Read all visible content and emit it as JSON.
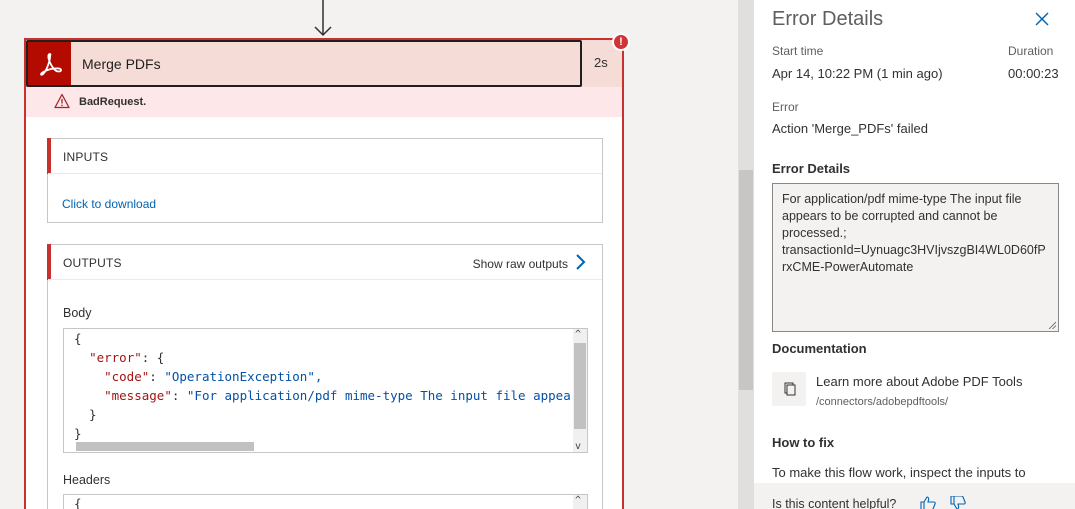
{
  "card": {
    "title": "Merge PDFs",
    "duration": "2s",
    "error_badge": "!",
    "status": "BadRequest.",
    "inputs": {
      "title": "INPUTS",
      "link": "Click to download"
    },
    "outputs": {
      "title": "OUTPUTS",
      "raw_link": "Show raw outputs",
      "body_label": "Body",
      "body_lines": [
        {
          "pre": "{",
          "key": "",
          "mid": "",
          "val": ""
        },
        {
          "pre": "  ",
          "key": "\"error\"",
          "mid": ": {",
          "val": ""
        },
        {
          "pre": "    ",
          "key": "\"code\"",
          "mid": ": ",
          "val": "\"OperationException\","
        },
        {
          "pre": "    ",
          "key": "\"message\"",
          "mid": ": ",
          "val": "\"For application/pdf mime-type The input file appear"
        },
        {
          "pre": "  }",
          "key": "",
          "mid": "",
          "val": ""
        },
        {
          "pre": "}",
          "key": "",
          "mid": "",
          "val": ""
        }
      ],
      "headers_label": "Headers",
      "headers_first_line": "{"
    }
  },
  "panel": {
    "title": "Error Details",
    "start_time_label": "Start time",
    "start_time": "Apr 14, 10:22 PM (1 min ago)",
    "duration_label": "Duration",
    "duration": "00:00:23",
    "error_label": "Error",
    "error": "Action 'Merge_PDFs' failed",
    "details_heading": "Error Details",
    "details_text": "For application/pdf mime-type The input file appears to be corrupted and cannot be processed.; transactionId=Uynuagc3HVIjvszgBI4WL0D60fPrxCME-PowerAutomate",
    "documentation_heading": "Documentation",
    "doc_link": "Learn more about Adobe PDF Tools",
    "doc_path": "/connectors/adobepdftools/",
    "fix_heading": "How to fix",
    "fix_text": "To make this flow work, inspect the inputs to",
    "helpful": "Is this content helpful?"
  },
  "colors": {
    "error_red": "#c8312e",
    "adobe_red": "#b30b00",
    "link_blue": "#0063b1",
    "header_pink": "#f6dcd6"
  },
  "icons": [
    "down-arrow-icon",
    "adobe-pdf-icon",
    "warning-icon",
    "chevron-right-icon",
    "close-icon",
    "document-copy-icon",
    "thumbs-up-icon",
    "thumbs-down-icon"
  ]
}
